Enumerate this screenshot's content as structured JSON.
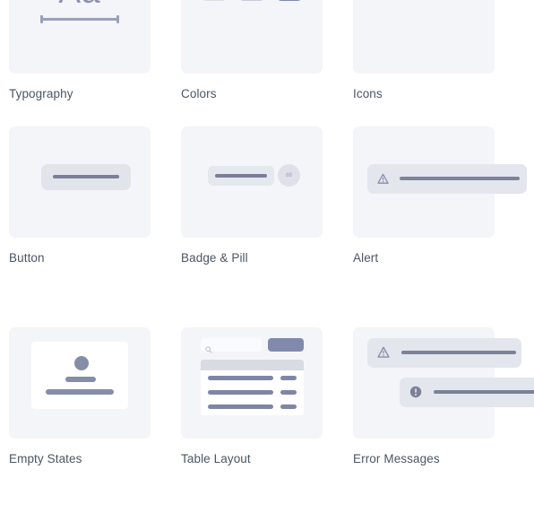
{
  "page": {
    "background_color": "#ffffff",
    "card_background": "#f4f5f9",
    "label_color": "#4b5563",
    "accent_color": "#818aad"
  },
  "cards": [
    {
      "label": "Typography",
      "thumbnail": "typography-preview",
      "sample_text": "Aa",
      "sample_color": "#8b91ad",
      "rule_color": "#9aa0b8"
    },
    {
      "label": "Colors",
      "thumbnail": "colors-preview",
      "swatches": [
        {
          "name": "swatch-light",
          "color": "#dcdee8"
        },
        {
          "name": "swatch-medium",
          "color": "#c6cadb"
        },
        {
          "name": "swatch-dark",
          "color": "#808aaf"
        }
      ]
    },
    {
      "label": "Icons",
      "thumbnail": "icons-preview",
      "icon_color": "#868da9",
      "icons": [
        {
          "name": "check-circle-icon"
        },
        {
          "name": "info-circle-icon"
        },
        {
          "name": "exclamation-circle-icon"
        }
      ]
    },
    {
      "label": "Button",
      "thumbnail": "button-preview",
      "button_fill": "#e2e4ec",
      "button_bar_color": "#787f97"
    },
    {
      "label": "Badge & Pill",
      "thumbnail": "badge-pill-preview",
      "pill_fill": "#e6e8ef",
      "badge_fill": "#dfe1ea",
      "badge_text": "88"
    },
    {
      "label": "Alert",
      "thumbnail": "alert-preview",
      "alert_fill": "#e4e6ee",
      "alert_icon": "warning-triangle-icon",
      "icon_color": "#868da9"
    },
    {
      "label": "Empty States",
      "thumbnail": "empty-states-preview",
      "panel_fill": "#ffffff",
      "figure_color": "#868da9"
    },
    {
      "label": "Table Layout",
      "thumbnail": "table-layout-preview",
      "search_icon": "magnifier-icon",
      "button_fill": "#818aad",
      "header_fill": "#d9dbe3",
      "row_bar_color": "#7e86a6",
      "row_count": 3
    },
    {
      "label": "Error Messages",
      "thumbnail": "error-messages-preview",
      "bar_fill": "#e4e6ee",
      "messages": [
        {
          "icon": "warning-triangle-icon"
        },
        {
          "icon": "exclamation-circle-icon"
        }
      ]
    }
  ]
}
